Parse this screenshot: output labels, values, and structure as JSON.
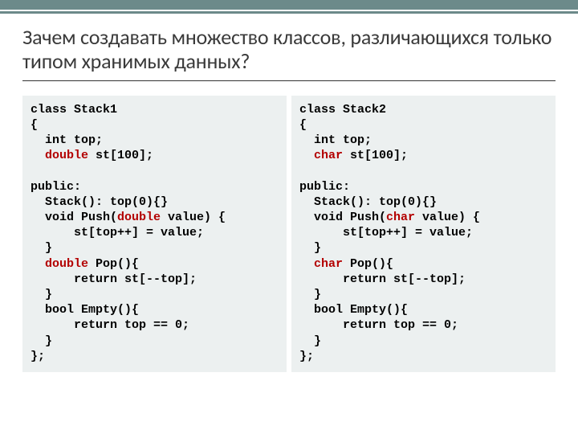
{
  "title": "Зачем создавать множество классов, различающихся только типом хранимых данных?",
  "code": {
    "left": {
      "l1a": "class Stack1",
      "l2": "{",
      "l3": "  int top;",
      "l4a": "  ",
      "l4k": "double",
      "l4b": " st[100];",
      "l5": "",
      "l6": "public:",
      "l7": "  Stack(): top(0){}",
      "l8a": "  void Push(",
      "l8k": "double",
      "l8b": " value) {",
      "l9": "      st[top++] = value;",
      "l10": "  }",
      "l11a": "  ",
      "l11k": "double",
      "l11b": " Pop(){",
      "l12": "      return st[--top];",
      "l13": "  }",
      "l14": "  bool Empty(){",
      "l15": "      return top == 0;",
      "l16": "  }",
      "l17": "};"
    },
    "right": {
      "l1a": "class Stack2",
      "l2": "{",
      "l3": "  int top;",
      "l4a": "  ",
      "l4k": "char",
      "l4b": " st[100];",
      "l5": "",
      "l6": "public:",
      "l7": "  Stack(): top(0){}",
      "l8a": "  void Push(",
      "l8k": "char",
      "l8b": " value) {",
      "l9": "      st[top++] = value;",
      "l10": "  }",
      "l11a": "  ",
      "l11k": "char",
      "l11b": " Pop(){",
      "l12": "      return st[--top];",
      "l13": "  }",
      "l14": "  bool Empty(){",
      "l15": "      return top == 0;",
      "l16": "  }",
      "l17": "};"
    }
  }
}
